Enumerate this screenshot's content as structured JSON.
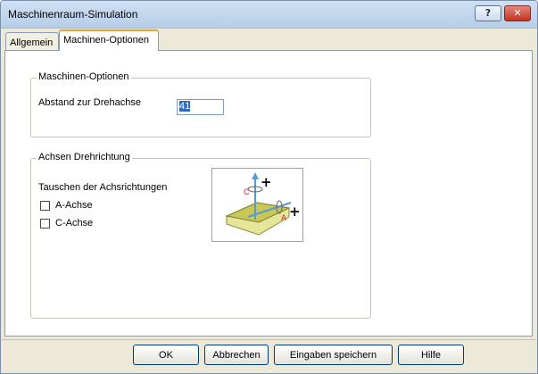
{
  "window": {
    "title": "Maschinenraum-Simulation",
    "help_icon": "?",
    "close_icon": "✕"
  },
  "tabs": [
    {
      "label": "Allgemein",
      "active": false
    },
    {
      "label": "Machinen-Optionen",
      "active": true
    }
  ],
  "maschinen_optionen": {
    "group_title": "Maschinen-Optionen",
    "abstand_label": "Abstand zur Drehachse",
    "abstand_value": "41"
  },
  "achsen": {
    "group_title": "Achsen Drehrichtung",
    "tauschen_label": "Tauschen der Achsrichtungen",
    "a_label": "A-Achse",
    "a_checked": false,
    "c_label": "C-Achse",
    "c_checked": false,
    "diagram": {
      "c_letter": "C",
      "a_letter": "A",
      "plus": "+"
    }
  },
  "buttons": {
    "ok": "OK",
    "abbrechen": "Abbrechen",
    "speichern": "Eingaben speichern",
    "hilfe": "Hilfe"
  },
  "colors": {
    "plate": "#c8c854",
    "axis_c": "#c82828",
    "axis_a": "#c82828",
    "axis_line": "#5a9ad2"
  }
}
